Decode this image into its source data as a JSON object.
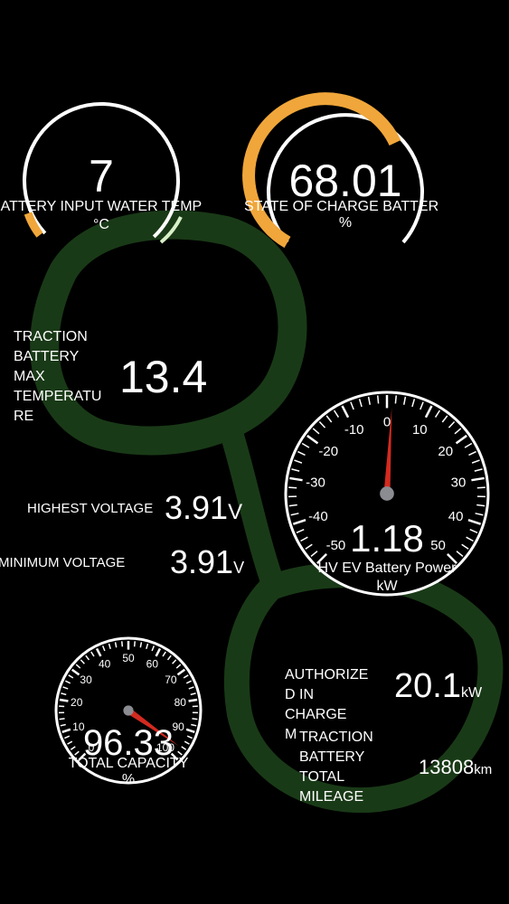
{
  "gauges": {
    "water_temp": {
      "value": "7",
      "label": "BATTERY INPUT WATER TEMP",
      "unit": "°C",
      "fill_fraction": 0.18,
      "arc_color": "#F0A63A"
    },
    "soc": {
      "value": "68.01",
      "label": "STATE OF CHARGE BATTER",
      "unit": "%",
      "fill_fraction": 0.68,
      "arc_color": "#F0A63A"
    },
    "traction_max_temp": {
      "label_lines": [
        "TRACTION",
        "BATTERY",
        "MAX",
        "TEMPERATU",
        "RE"
      ],
      "value": "13.4"
    },
    "highest_voltage": {
      "label": "HIGHEST VOLTAGE",
      "value": "3.91",
      "unit": "V"
    },
    "minimum_voltage": {
      "label": "MINIMUM VOLTAGE",
      "value": "3.91",
      "unit": "V"
    },
    "hv_power": {
      "value": "1.18",
      "label": "HV EV Battery Power",
      "unit": "kW",
      "ticks": [
        "-50",
        "-40",
        "-30",
        "-20",
        "-10",
        "0",
        "10",
        "20",
        "30",
        "40",
        "50"
      ],
      "needle_value": 1.18,
      "needle_color": "#D42A20"
    },
    "total_capacity": {
      "value": "96.33",
      "label": "TOTAL CAPACITY",
      "unit": "%",
      "ticks": [
        "0",
        "10",
        "20",
        "30",
        "40",
        "50",
        "60",
        "70",
        "80",
        "90",
        "100"
      ],
      "needle_value": 96.33,
      "needle_color": "#D42A20"
    },
    "authorized_charge": {
      "label_lines": [
        "AUTHORIZE",
        "D IN",
        "CHARGE",
        "M"
      ],
      "value": "20.1",
      "unit": "kW"
    },
    "total_mileage": {
      "label_lines": [
        "TRACTION",
        "BATTERY",
        "TOTAL",
        "MILEAGE"
      ],
      "value": "13808",
      "unit": "km"
    }
  },
  "colors": {
    "background": "#000000",
    "accent_orange": "#F0A63A",
    "needle_red": "#D42A20",
    "overlay_green": "#2E6B2A"
  }
}
